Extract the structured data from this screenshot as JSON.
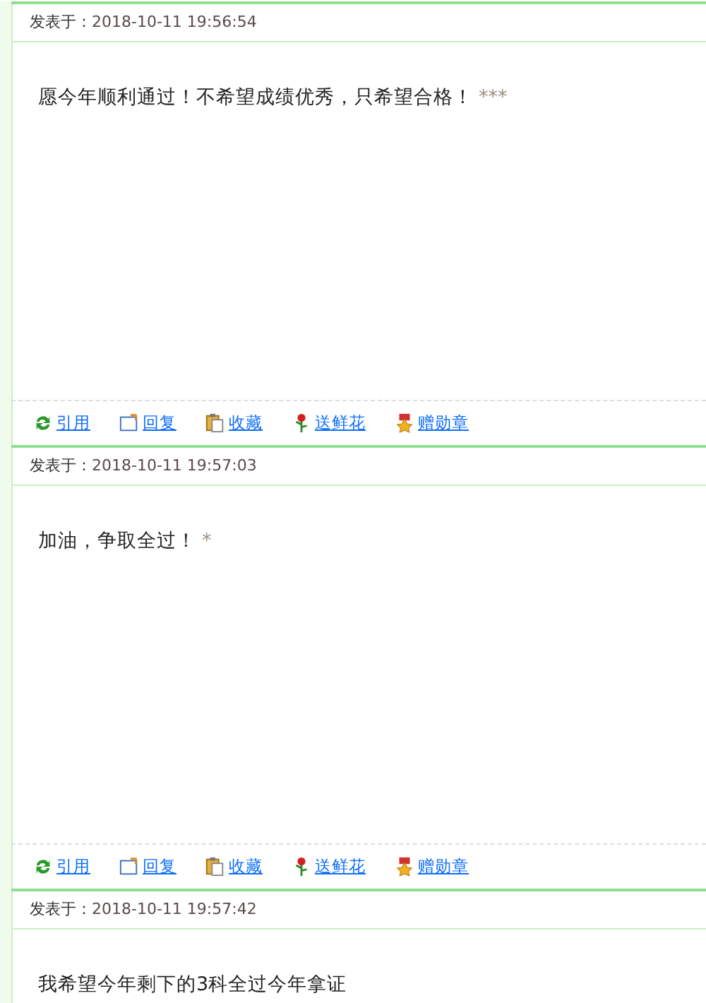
{
  "posts": [
    {
      "posted_label": "发表于：",
      "date": "2018-10-11 19:56:54",
      "content": "愿今年顺利通过！不希望成绩优秀，只希望合格！",
      "masked": "***",
      "actions": [
        {
          "kind": "quote",
          "label": "引用"
        },
        {
          "kind": "reply",
          "label": "回复"
        },
        {
          "kind": "favorite",
          "label": "收藏"
        },
        {
          "kind": "flower",
          "label": "送鲜花"
        },
        {
          "kind": "medal",
          "label": "赠勋章"
        }
      ]
    },
    {
      "posted_label": "发表于：",
      "date": "2018-10-11 19:57:03",
      "content": "加油，争取全过！",
      "masked": "*",
      "actions": [
        {
          "kind": "quote",
          "label": "引用"
        },
        {
          "kind": "reply",
          "label": "回复"
        },
        {
          "kind": "favorite",
          "label": "收藏"
        },
        {
          "kind": "flower",
          "label": "送鲜花"
        },
        {
          "kind": "medal",
          "label": "赠勋章"
        }
      ]
    },
    {
      "posted_label": "发表于：",
      "date": "2018-10-11 19:57:42",
      "content": "我希望今年剩下的3科全过今年拿证"
    }
  ]
}
